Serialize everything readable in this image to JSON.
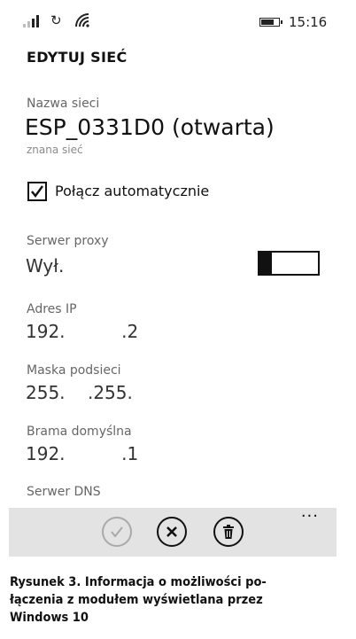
{
  "status_bar": {
    "time": "15:16",
    "signal_icon": "signal-icon",
    "sync_icon": "sync-icon",
    "wifi_icon": "wifi-icon",
    "battery_icon": "battery-icon"
  },
  "page_title": "EDYTUJ SIEĆ",
  "network": {
    "label": "Nazwa sieci",
    "name": "ESP_0331D0 (otwarta)",
    "status": "znana sieć"
  },
  "auto_connect": {
    "label": "Połącz automatycznie",
    "checked": true
  },
  "proxy": {
    "label": "Serwer proxy",
    "value": "Wył.",
    "enabled": false
  },
  "ip_address": {
    "label": "Adres IP",
    "value": "192.          .2"
  },
  "subnet_mask": {
    "label": "Maska podsieci",
    "value": "255.    .255."
  },
  "gateway": {
    "label": "Brama domyślna",
    "value": "192.          .1"
  },
  "dns": {
    "label": "Serwer DNS"
  },
  "app_bar": {
    "save_icon": "check-circle-icon",
    "cancel_icon": "close-circle-icon",
    "delete_icon": "trash-icon",
    "more_label": "..."
  },
  "caption": {
    "line1": "Rysunek 3. Informacja o możliwości po-",
    "line2": "łączenia z modułem wyświetlana przez",
    "line3": "Windows 10"
  }
}
